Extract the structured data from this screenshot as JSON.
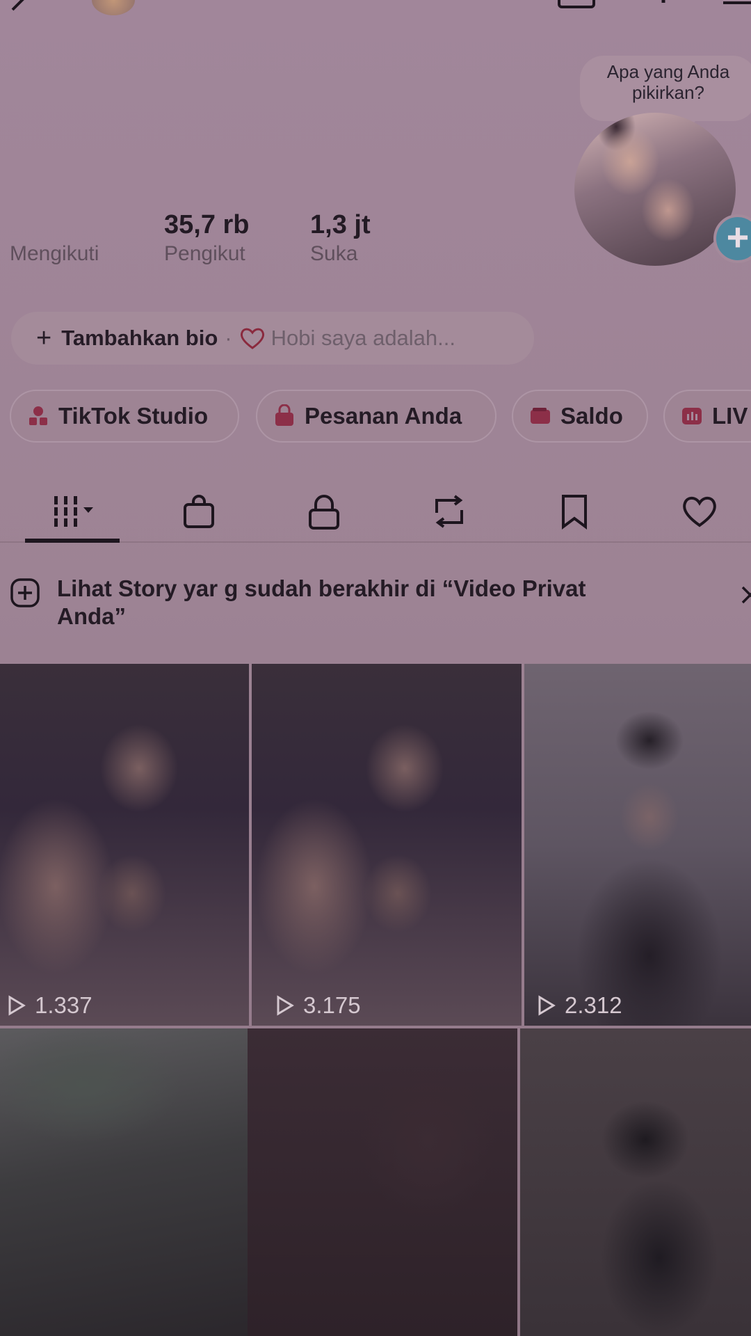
{
  "bubble": {
    "line1": "Apa yang Anda",
    "line2": "pikirkan?"
  },
  "stats": {
    "following": {
      "value": "",
      "label": "Mengikuti"
    },
    "followers": {
      "value": "35,7 rb",
      "label": "Pengikut"
    },
    "likes": {
      "value": "1,3 jt",
      "label": "Suka"
    }
  },
  "bio": {
    "add_label": "Tambahkan bio",
    "separator": "·",
    "hobby_placeholder": "Hobi saya adalah..."
  },
  "quick_buttons": [
    {
      "label": "TikTok Studio",
      "icon": "studio-icon"
    },
    {
      "label": "Pesanan Anda",
      "icon": "shopping-bag-icon"
    },
    {
      "label": "Saldo",
      "icon": "wallet-icon"
    },
    {
      "label": "LIV",
      "icon": "live-icon"
    }
  ],
  "tabs": [
    {
      "name": "videos",
      "icon": "grid-icon",
      "active": true
    },
    {
      "name": "shop",
      "icon": "bag-icon"
    },
    {
      "name": "private",
      "icon": "lock-icon"
    },
    {
      "name": "reposts",
      "icon": "repost-icon"
    },
    {
      "name": "favorites",
      "icon": "bookmark-icon"
    },
    {
      "name": "liked",
      "icon": "heart-icon"
    }
  ],
  "notice": {
    "text": "Lihat Story yar g sudah berakhir di “Video Privat Anda”"
  },
  "videos": [
    {
      "views": "1.337"
    },
    {
      "views": "3.175"
    },
    {
      "views": "2.312"
    },
    {
      "views": ""
    },
    {
      "views": ""
    },
    {
      "views": ""
    }
  ],
  "colors": {
    "background": "#9c8291",
    "text": "#1f1620",
    "accent_plus": "#4d88a0"
  }
}
